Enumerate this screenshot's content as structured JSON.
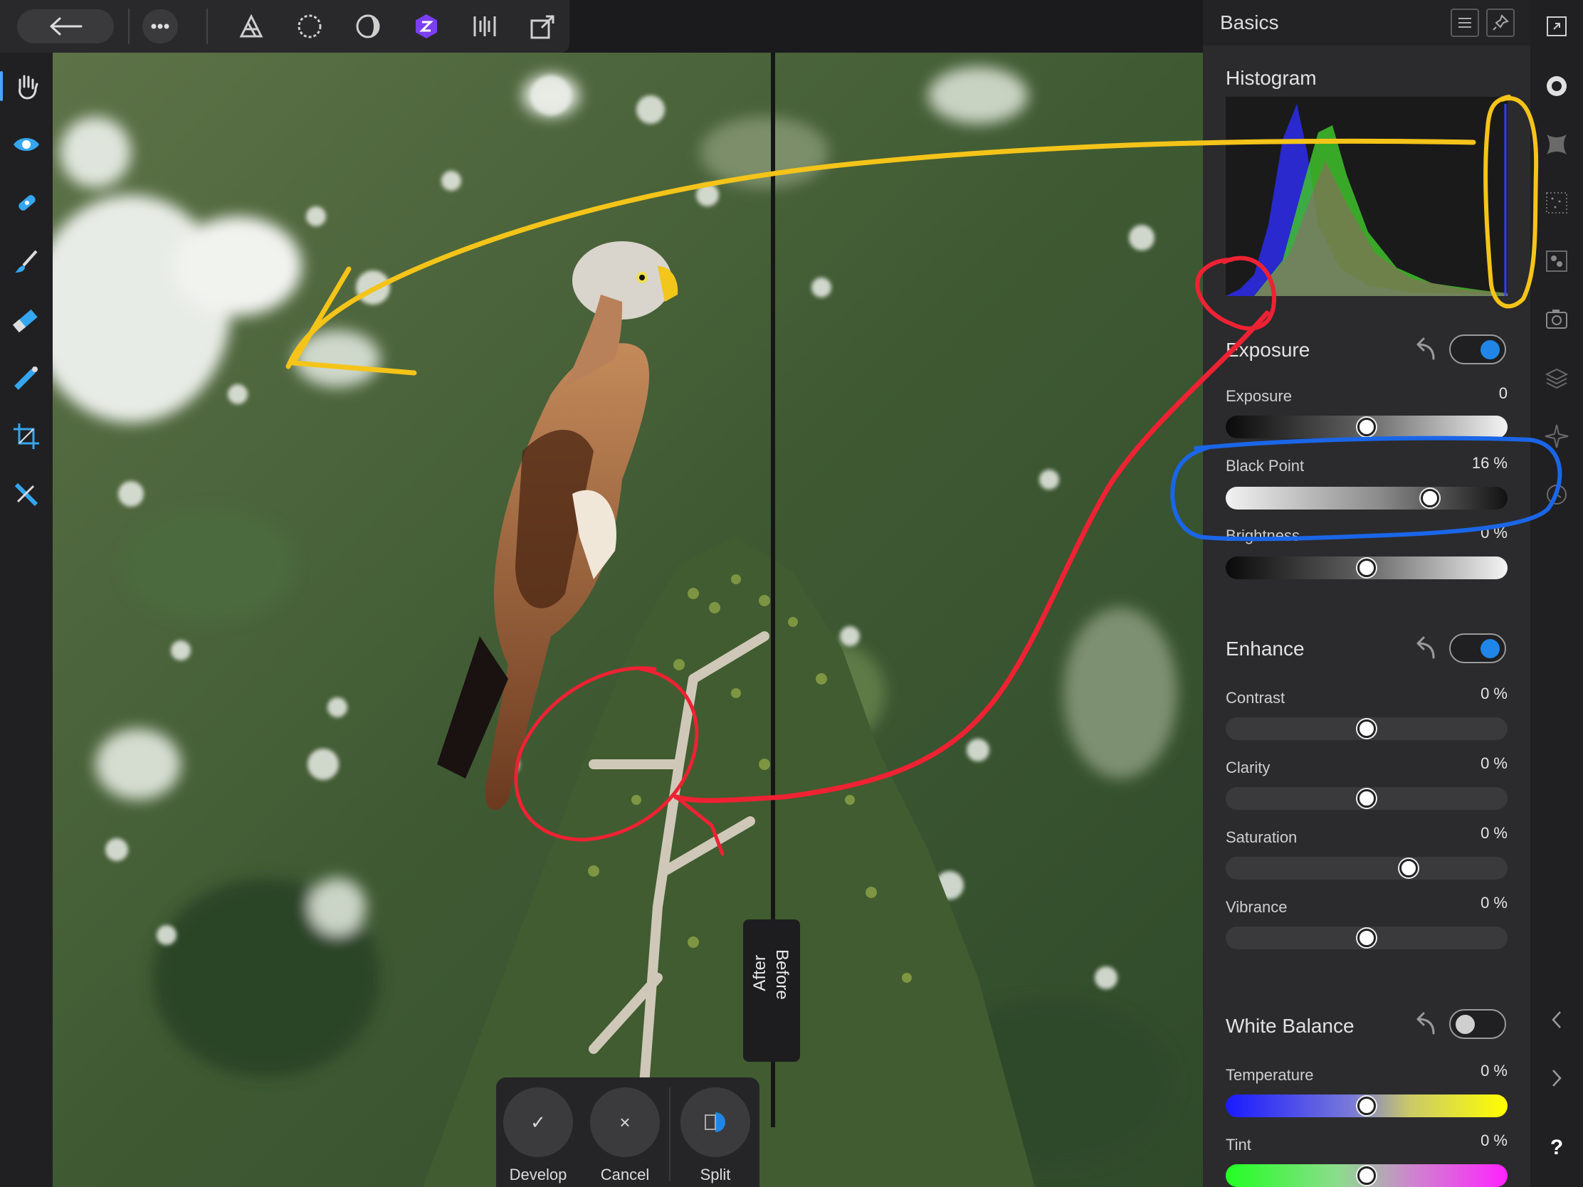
{
  "toolbar": {
    "back_icon": "arrow-left-icon",
    "more_icon": "more-dots-icon",
    "personas": [
      "photo-persona-icon",
      "liquify-persona-icon",
      "develop-persona-icon",
      "develop-active-icon",
      "tone-mapping-icon",
      "export-persona-icon"
    ]
  },
  "left_tools": [
    "hand-tool-icon",
    "red-eye-tool-icon",
    "healing-tool-icon",
    "brush-tool-icon",
    "eraser-tool-icon",
    "gradient-tool-icon",
    "crop-tool-icon",
    "overlay-tool-icon"
  ],
  "split_view": {
    "after_label": "After",
    "before_label": "Before"
  },
  "actions": {
    "develop_label": "Develop",
    "cancel_label": "Cancel",
    "split_label": "Split",
    "develop_glyph": "✓",
    "cancel_glyph": "×"
  },
  "panel": {
    "title": "Basics",
    "histogram_title": "Histogram",
    "exposure": {
      "title": "Exposure",
      "enabled": true,
      "controls": [
        {
          "label": "Exposure",
          "value": "0",
          "level": 0.5
        },
        {
          "label": "Black Point",
          "value": "16 %",
          "level": 0.74
        },
        {
          "label": "Brightness",
          "value": "0 %",
          "level": 0.5
        }
      ]
    },
    "enhance": {
      "title": "Enhance",
      "enabled": true,
      "controls": [
        {
          "label": "Contrast",
          "value": "0 %",
          "level": 0.5
        },
        {
          "label": "Clarity",
          "value": "0 %",
          "level": 0.5
        },
        {
          "label": "Saturation",
          "value": "0 %",
          "level": 0.66
        },
        {
          "label": "Vibrance",
          "value": "0 %",
          "level": 0.5
        }
      ]
    },
    "white_balance": {
      "title": "White Balance",
      "enabled": false,
      "controls": [
        {
          "label": "Temperature",
          "value": "0 %",
          "level": 0.5
        },
        {
          "label": "Tint",
          "value": "0 %",
          "level": 0.5
        }
      ]
    }
  },
  "right_strip": {
    "help_label": "?",
    "icons": [
      "fullscreen-icon",
      "basics-studio-icon",
      "lens-studio-icon",
      "noise-studio-icon",
      "details-studio-icon",
      "overlays-studio-icon",
      "layers-studio-icon",
      "navigator-studio-icon",
      "history-studio-icon",
      "collapse-left-icon",
      "expand-right-icon",
      "help-icon"
    ]
  },
  "colors": {
    "accent": "#1f86e8",
    "persona_active": "#7b3ff2",
    "annotation_yellow": "#f5c419",
    "annotation_red": "#ee2233",
    "annotation_blue": "#1a66e8"
  }
}
